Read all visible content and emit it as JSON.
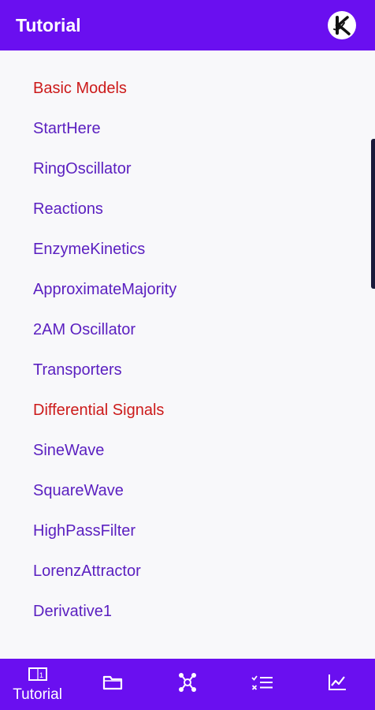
{
  "app_bar": {
    "title": "Tutorial",
    "logo_icon": "kaemika-logo-icon"
  },
  "colors": {
    "primary": "#6a0ff0",
    "item_text": "#5a1fc0",
    "section_text": "#cc1a1a",
    "background": "#f8f8fa"
  },
  "list": {
    "items": [
      {
        "label": "Basic Models",
        "type": "section"
      },
      {
        "label": "StartHere",
        "type": "item"
      },
      {
        "label": "RingOscillator",
        "type": "item"
      },
      {
        "label": "Reactions",
        "type": "item"
      },
      {
        "label": "EnzymeKinetics",
        "type": "item"
      },
      {
        "label": "ApproximateMajority",
        "type": "item"
      },
      {
        "label": "2AM Oscillator",
        "type": "item"
      },
      {
        "label": "Transporters",
        "type": "item"
      },
      {
        "label": "Differential Signals",
        "type": "section"
      },
      {
        "label": "SineWave",
        "type": "item"
      },
      {
        "label": "SquareWave",
        "type": "item"
      },
      {
        "label": "HighPassFilter",
        "type": "item"
      },
      {
        "label": "LorenzAttractor",
        "type": "item"
      },
      {
        "label": "Derivative1",
        "type": "item"
      }
    ]
  },
  "bottom_nav": {
    "items": [
      {
        "icon": "tutorial-book-icon",
        "label": "Tutorial",
        "selected": true
      },
      {
        "icon": "folder-icon",
        "label": "",
        "selected": false
      },
      {
        "icon": "network-icon",
        "label": "",
        "selected": false
      },
      {
        "icon": "checklist-icon",
        "label": "",
        "selected": false
      },
      {
        "icon": "chart-icon",
        "label": "",
        "selected": false
      }
    ]
  }
}
